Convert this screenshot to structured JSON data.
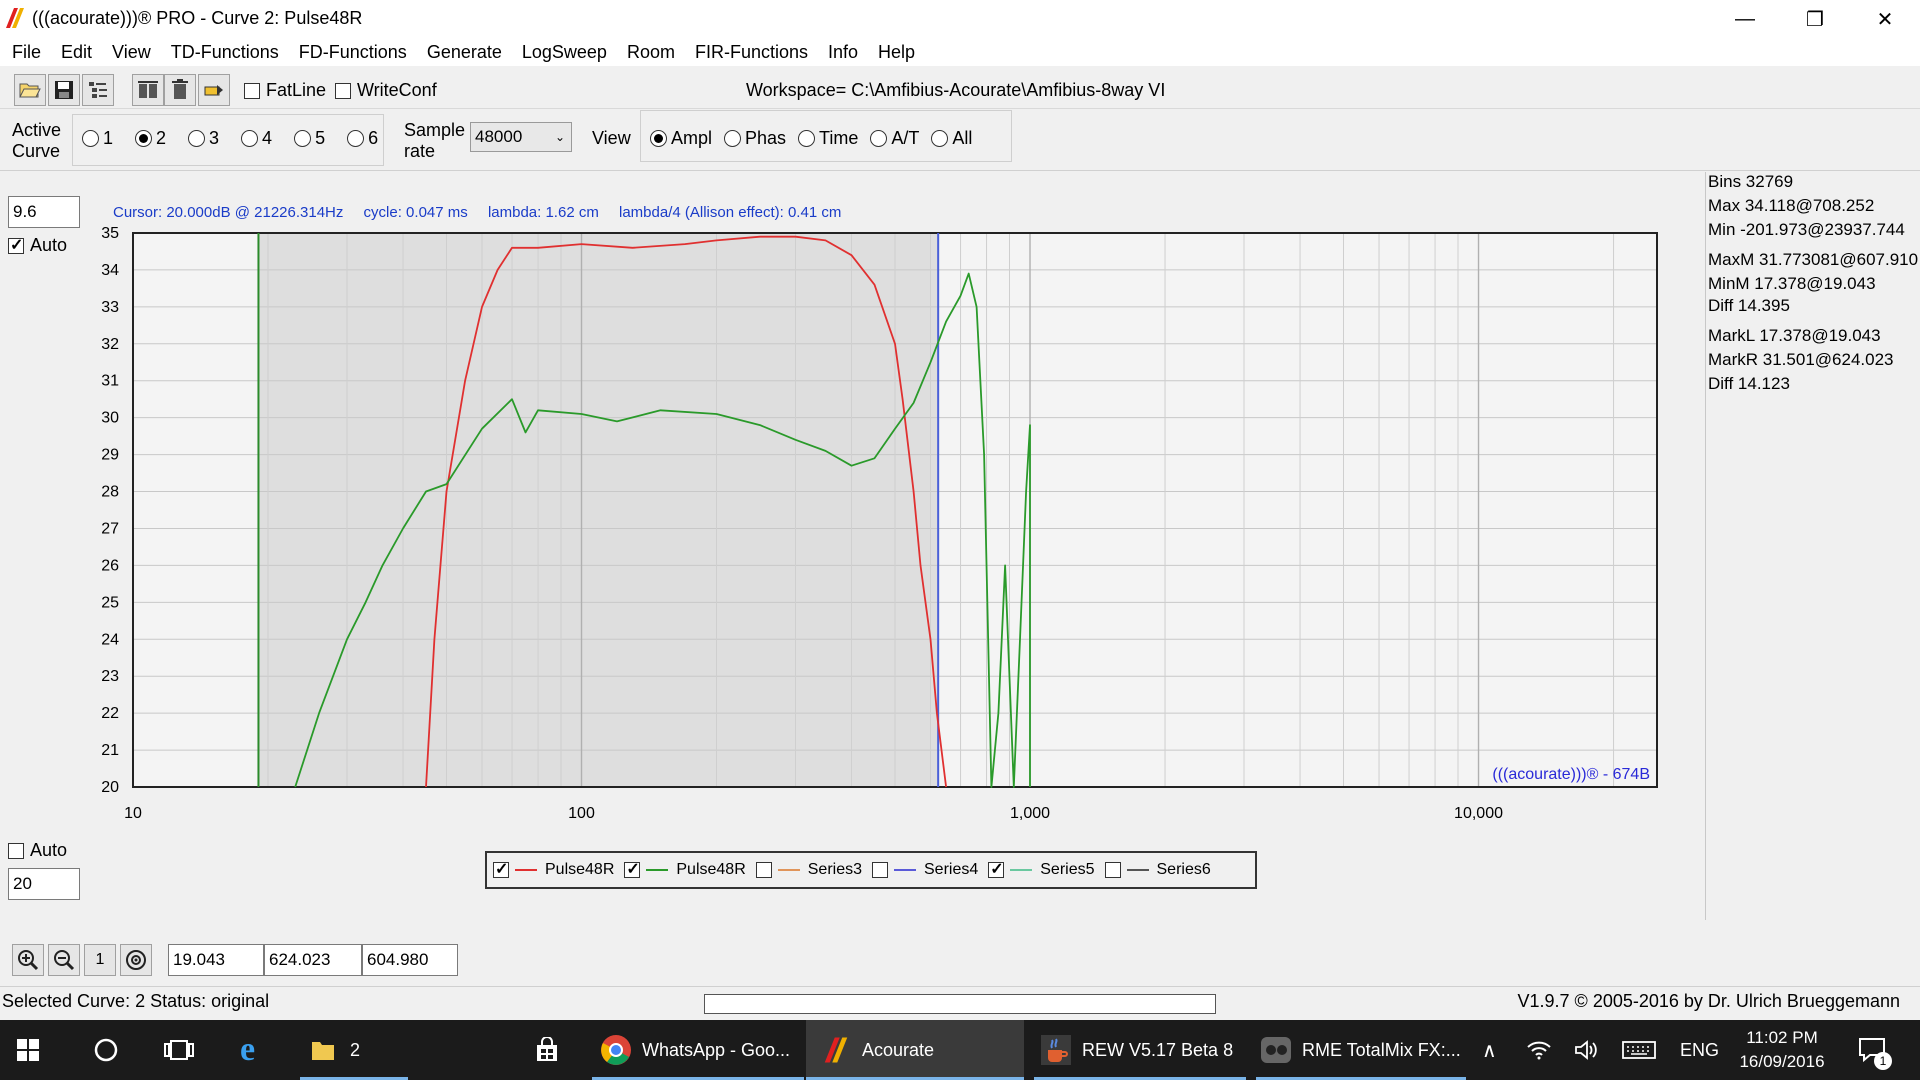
{
  "window": {
    "title": "(((acourate)))® PRO - Curve 2: Pulse48R"
  },
  "menu": [
    "File",
    "Edit",
    "View",
    "TD-Functions",
    "FD-Functions",
    "Generate",
    "LogSweep",
    "Room",
    "FIR-Functions",
    "Info",
    "Help"
  ],
  "toolbar": {
    "fatline_label": "FatLine",
    "fatline_checked": false,
    "writeconf_label": "WriteConf",
    "writeconf_checked": false,
    "workspace": "Workspace= C:\\Amfibius-Acourate\\Amfibius-8way VI"
  },
  "active_curve": {
    "label_line1": "Active",
    "label_line2": "Curve",
    "options": [
      "1",
      "2",
      "3",
      "4",
      "5",
      "6"
    ],
    "selected": "2"
  },
  "sample_rate": {
    "label_line1": "Sample",
    "label_line2": "rate",
    "value": "48000"
  },
  "view": {
    "label": "View",
    "options": [
      "Ampl",
      "Phas",
      "Time",
      "A/T",
      "All"
    ],
    "selected": "Ampl"
  },
  "y_axis": {
    "top_value": "9.6",
    "top_auto_label": "Auto",
    "top_auto_checked": true,
    "bottom_auto_label": "Auto",
    "bottom_auto_checked": false,
    "bottom_value": "20"
  },
  "cursor": {
    "value": "Cursor:  20.000dB @ 21226.314Hz",
    "cycle": "cycle: 0.047 ms",
    "lambda": "lambda: 1.62 cm",
    "lambda4": "lambda/4 (Allison effect): 0.41 cm"
  },
  "watermark": "(((acourate)))® - 674B",
  "info": {
    "bins": "Bins 32769",
    "max": "Max 34.118@708.252",
    "min": "Min -201.973@23937.744",
    "maxm": "MaxM 31.773081@607.910",
    "minm": "MinM 17.378@19.043",
    "diff1": "Diff 14.395",
    "markl": "MarkL 17.378@19.043",
    "markr": "MarkR 31.501@624.023",
    "diff2": "Diff 14.123"
  },
  "legend": [
    {
      "name": "Pulse48R",
      "checked": true,
      "color": "#e03030"
    },
    {
      "name": "Pulse48R",
      "checked": true,
      "color": "#2a9a2a"
    },
    {
      "name": "Series3",
      "checked": false,
      "color": "#e0945a"
    },
    {
      "name": "Series4",
      "checked": false,
      "color": "#5a5ad8"
    },
    {
      "name": "Series5",
      "checked": true,
      "color": "#6ac8a0"
    },
    {
      "name": "Series6",
      "checked": false,
      "color": "#555555"
    }
  ],
  "bottom_fields": {
    "one_label": "1",
    "markl": "19.043",
    "markr": "624.023",
    "delta": "604.980"
  },
  "status": {
    "left": "Selected Curve: 2   Status: original",
    "right": "V1.9.7 © 2005-2016 by Dr. Ulrich Brueggemann"
  },
  "taskbar": {
    "explorer_count": "2",
    "items": [
      "WhatsApp - Goo...",
      "Acourate",
      "REW V5.17 Beta 8",
      "RME TotalMix FX:..."
    ],
    "lang": "ENG",
    "time": "11:02 PM",
    "date": "16/09/2016",
    "notif_count": "1"
  },
  "chart_data": {
    "type": "line",
    "x_scale": "log",
    "xlim": [
      10,
      25000
    ],
    "ylim": [
      20,
      35
    ],
    "x_tick_labels": [
      "10",
      "100",
      "1,000",
      "10,000"
    ],
    "y_tick_labels": [
      "20",
      "21",
      "22",
      "23",
      "24",
      "25",
      "26",
      "27",
      "28",
      "29",
      "30",
      "31",
      "32",
      "33",
      "34",
      "35"
    ],
    "markers": {
      "left_hz": 19.043,
      "right_hz": 624.023
    },
    "series": [
      {
        "name": "Pulse48R",
        "color": "#e03030",
        "x": [
          45,
          47,
          50,
          55,
          60,
          65,
          70,
          80,
          100,
          130,
          170,
          200,
          250,
          300,
          350,
          400,
          450,
          500,
          520,
          550,
          570,
          600,
          620,
          650
        ],
        "y": [
          20,
          24,
          28,
          31,
          33,
          34,
          34.6,
          34.6,
          34.7,
          34.6,
          34.7,
          34.8,
          34.9,
          34.9,
          34.8,
          34.4,
          33.6,
          32,
          30.5,
          28,
          26,
          24,
          22,
          20
        ]
      },
      {
        "name": "Pulse48R",
        "color": "#2a9a2a",
        "x": [
          23,
          26,
          30,
          33,
          36,
          40,
          45,
          50,
          60,
          70,
          75,
          80,
          100,
          120,
          150,
          200,
          250,
          300,
          350,
          400,
          450,
          500,
          550,
          600,
          650,
          700,
          730,
          760,
          790,
          820,
          850,
          880,
          920,
          950,
          980,
          1000,
          1000
        ],
        "y": [
          20,
          22,
          24,
          25,
          26,
          27,
          28,
          28.2,
          29.7,
          30.5,
          29.6,
          30.2,
          30.1,
          29.9,
          30.2,
          30.1,
          29.8,
          29.4,
          29.1,
          28.7,
          28.9,
          29.7,
          30.4,
          31.5,
          32.6,
          33.3,
          33.9,
          33,
          29,
          20,
          22,
          26,
          20,
          24,
          28,
          29.8,
          20
        ]
      }
    ]
  }
}
